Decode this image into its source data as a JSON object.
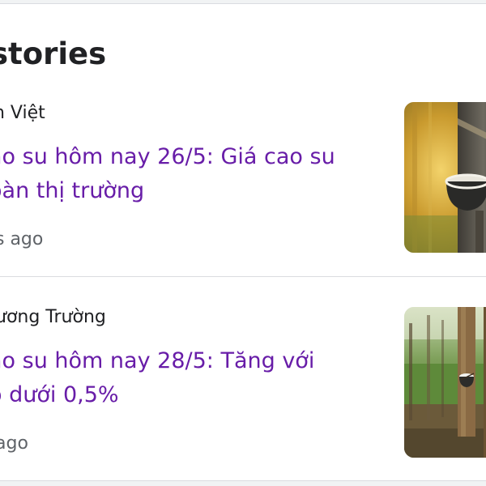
{
  "section": {
    "title": "stories"
  },
  "stories": [
    {
      "source": "n Việt",
      "headline_line1": "ao su hôm nay 26/5: Giá cao su",
      "headline_line2": "oàn thị trường",
      "time": "s ago",
      "thumbnail_icon": "rubber-tapping-photo"
    },
    {
      "source": "ương Trường",
      "headline_line1": "ao su hôm nay 28/5: Tăng với",
      "headline_line2": "ộ dưới 0,5%",
      "time": "ago",
      "thumbnail_icon": "rubber-plantation-photo"
    }
  ],
  "colors": {
    "headline": "#681da8",
    "meta": "#5f6368",
    "text": "#202124",
    "divider": "#dadce0"
  }
}
